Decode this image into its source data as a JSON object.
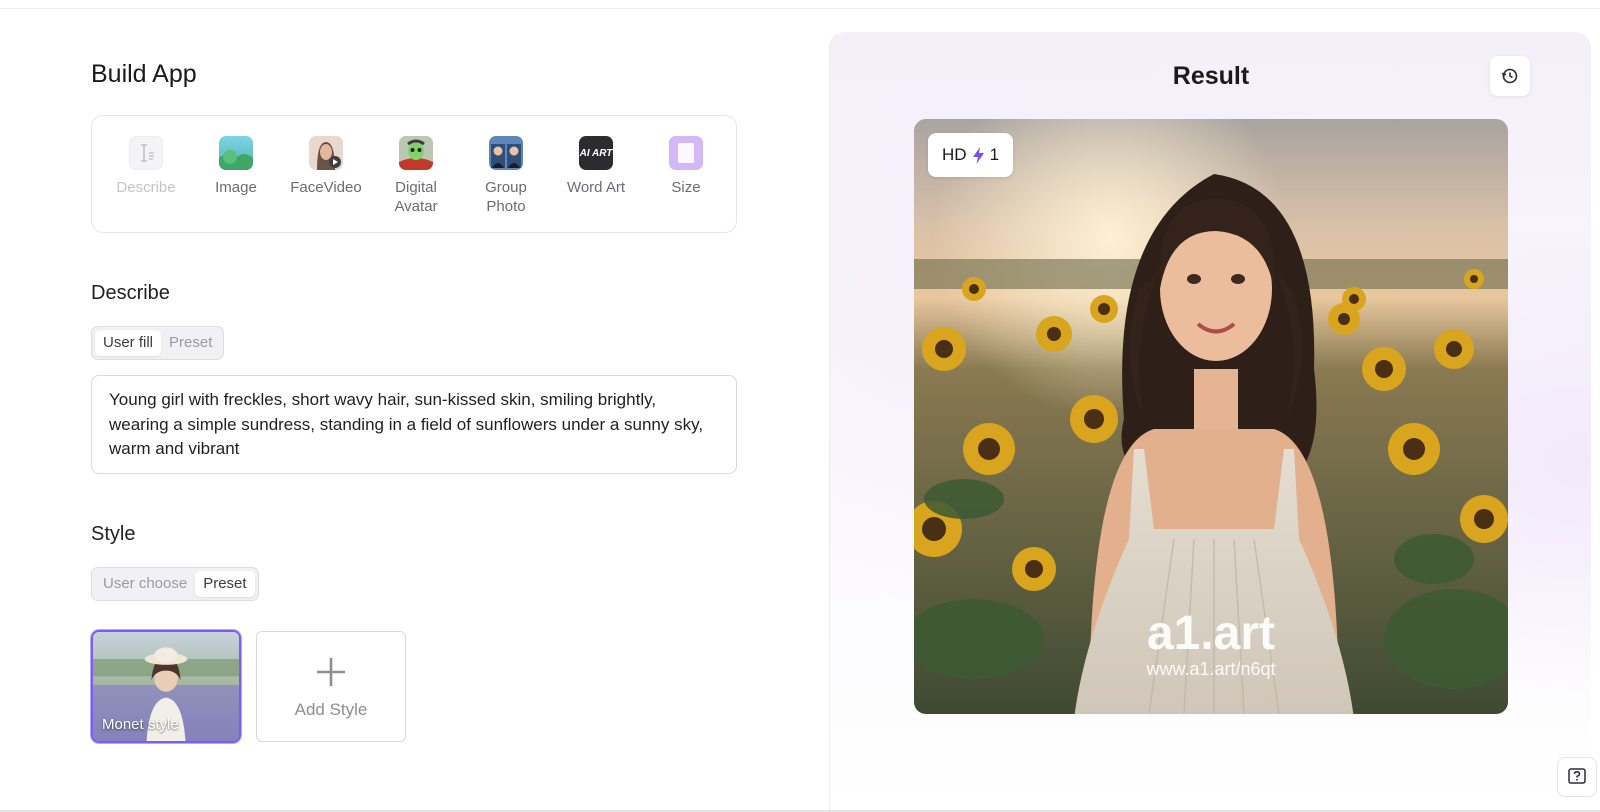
{
  "builder": {
    "title": "Build App",
    "types": [
      {
        "label": "Describe",
        "icon": "describe-icon",
        "disabled": true
      },
      {
        "label": "Image",
        "icon": "image-icon"
      },
      {
        "label": "FaceVideo",
        "icon": "face-video-icon"
      },
      {
        "label": "Digital Avatar",
        "icon": "digital-avatar-icon"
      },
      {
        "label": "Group Photo",
        "icon": "group-photo-icon"
      },
      {
        "label": "Word Art",
        "icon": "word-art-icon",
        "icon_text": "AI ART"
      },
      {
        "label": "Size",
        "icon": "size-icon"
      }
    ]
  },
  "describe": {
    "title": "Describe",
    "modes": [
      "User fill",
      "Preset"
    ],
    "active_mode": "User fill",
    "text": "Young girl with freckles, short wavy hair, sun-kissed skin, smiling brightly, wearing a simple sundress, standing in a field of sunflowers under a sunny sky, warm and vibrant"
  },
  "style": {
    "title": "Style",
    "modes": [
      "User choose",
      "Preset"
    ],
    "active_mode": "Preset",
    "selected_style": "Monet style",
    "add_label": "Add Style"
  },
  "result": {
    "title": "Result",
    "badge_quality": "HD",
    "badge_count": "1",
    "watermark_logo": "a1.art",
    "watermark_url": "www.a1.art/n6qt"
  },
  "colors": {
    "accent": "#7c5cf2",
    "bolt": "#7b4ff0"
  }
}
